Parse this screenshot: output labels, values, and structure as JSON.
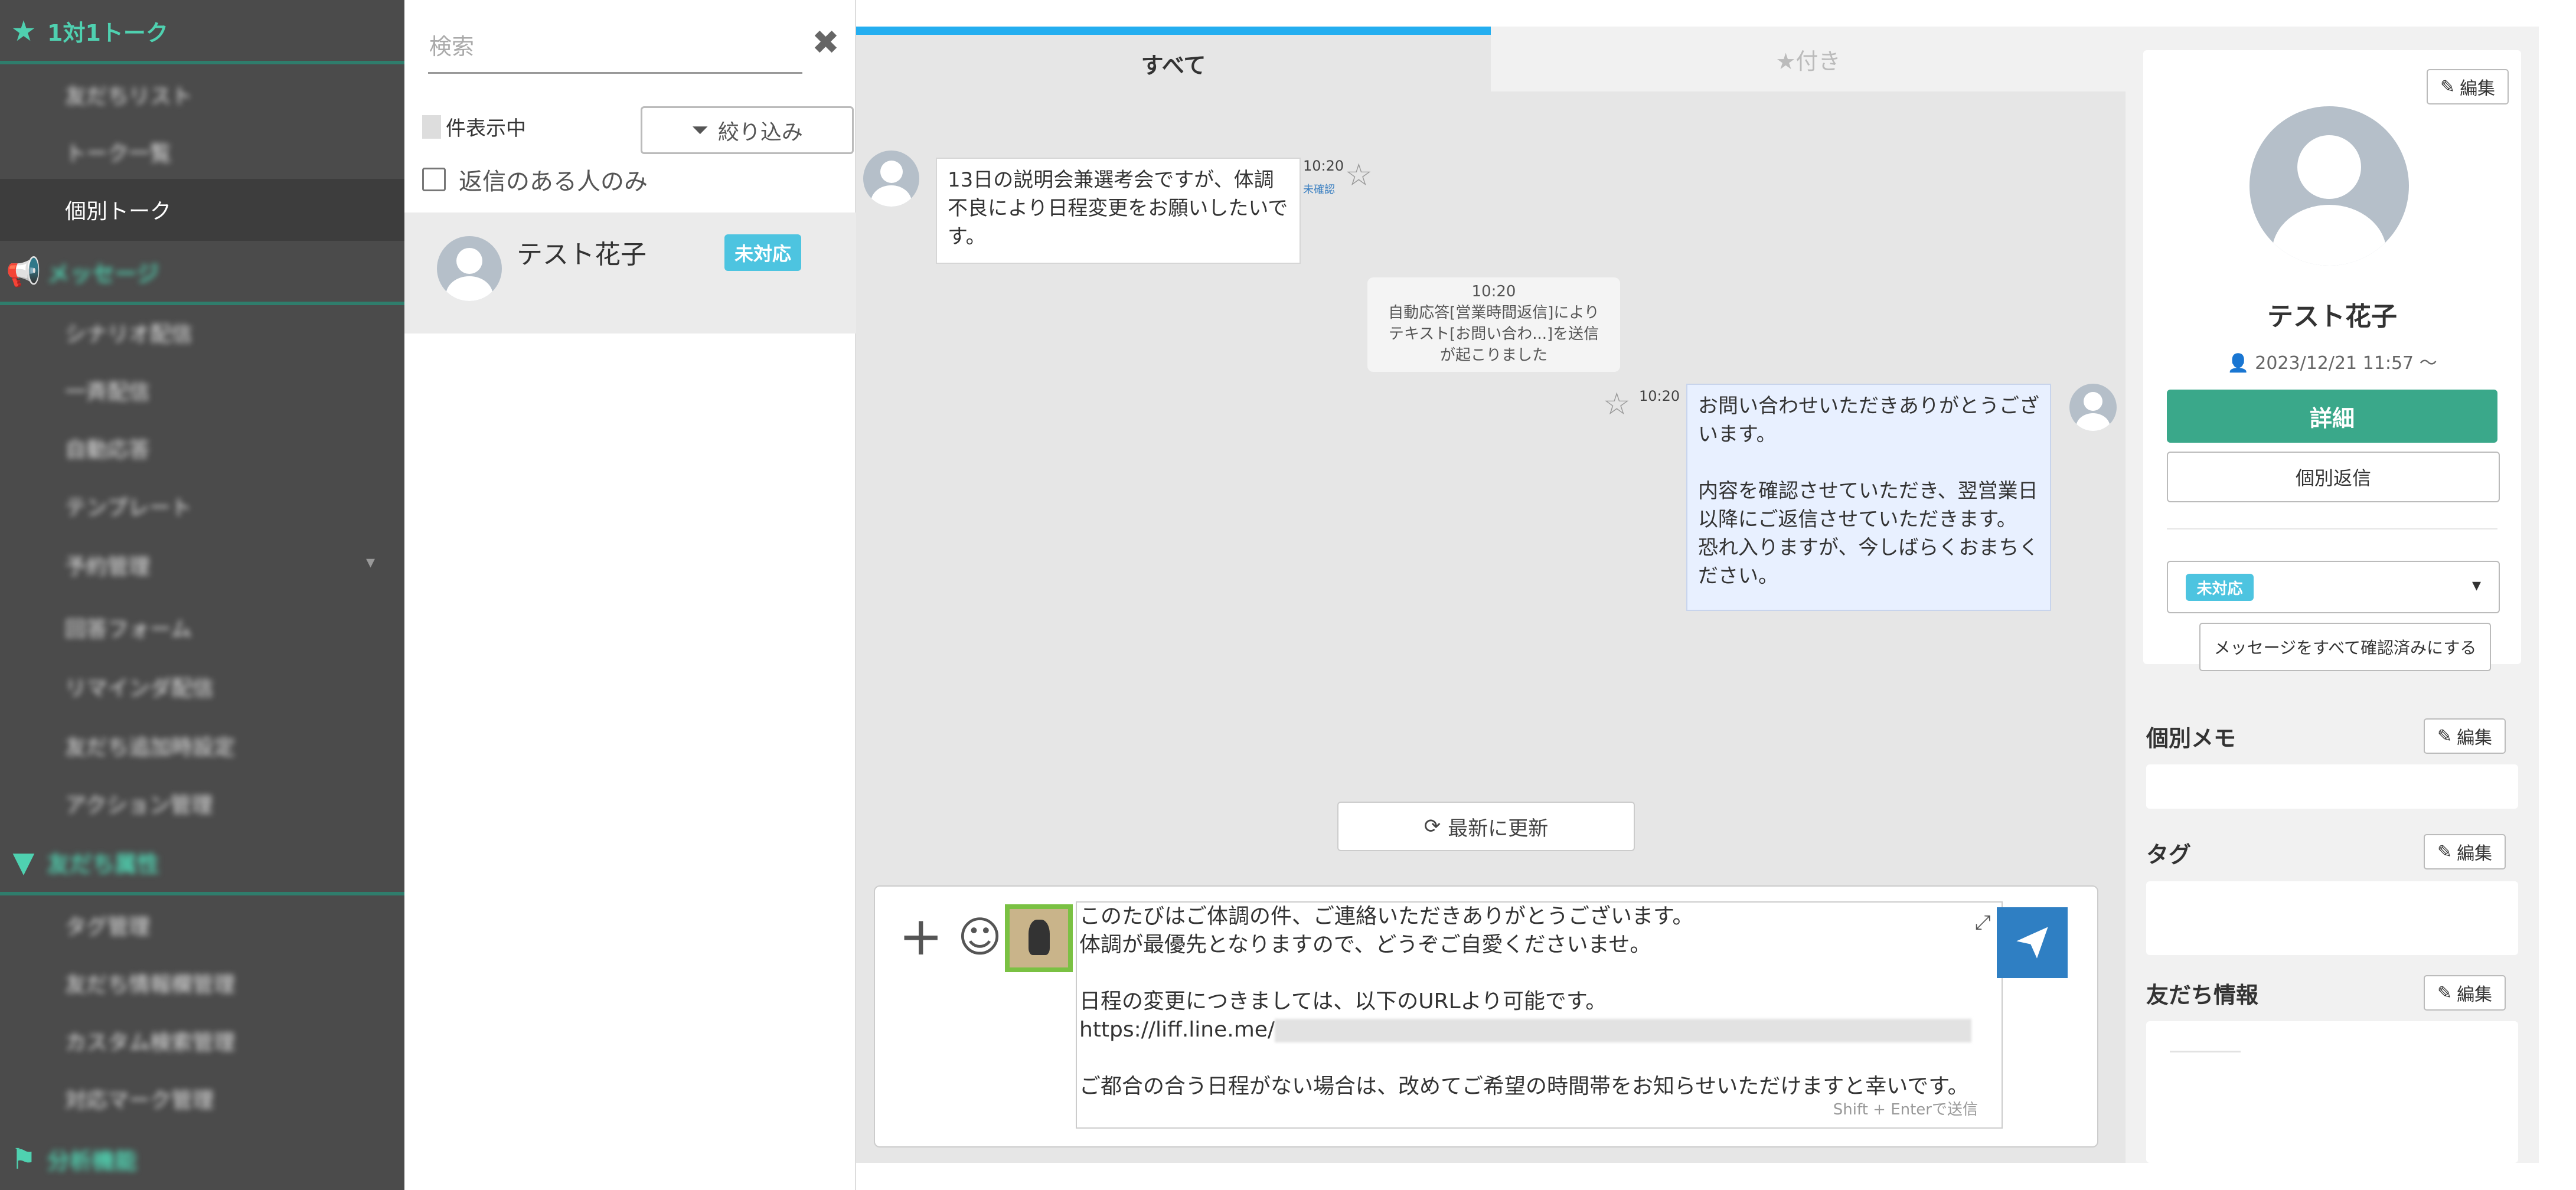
{
  "sidebar": {
    "sections": [
      {
        "label": "1対1トーク",
        "icon": "star-icon"
      },
      {
        "label": "メッセージ",
        "icon": "megaphone-icon"
      },
      {
        "label": "友だち属性",
        "icon": "filter-icon"
      },
      {
        "label": "分析機能",
        "icon": "flag-icon"
      }
    ],
    "items_talk": [
      "友だちリスト",
      "トーク一覧",
      "個別トーク"
    ],
    "items_message": [
      "シナリオ配信",
      "一斉配信",
      "自動応答",
      "テンプレート",
      "予約管理",
      "回答フォーム",
      "リマインダ配信",
      "友だち追加時設定",
      "アクション管理"
    ],
    "items_attr": [
      "タグ管理",
      "友だち情報欄管理",
      "カスタム検索管理",
      "対応マーク管理"
    ]
  },
  "list": {
    "search_placeholder": "検索",
    "count_label": "件表示中",
    "filter_label": "絞り込み",
    "reply_only_label": "返信のある人のみ",
    "conversations": [
      {
        "name": "テスト花子",
        "status": "未対応"
      }
    ]
  },
  "chat": {
    "tab_all": "すべて",
    "tab_starred": "★付き",
    "messages": {
      "incoming_lines": [
        "13日の説明会兼選考会ですが、体調",
        "不良により日程変更をお願いしたいで",
        "す。"
      ],
      "incoming_time": "10:20",
      "incoming_status": "未確認",
      "system_time": "10:20",
      "system_lines": [
        "自動応答[営業時間返信]により",
        "テキスト[お問い合わ...]を送信",
        "が起こりました"
      ],
      "outgoing_time": "10:20",
      "outgoing_lines": [
        "お問い合わせいただきありがとうござ",
        "います。",
        "",
        "内容を確認させていただき、翌営業日",
        "以降にご返信させていただきます。",
        "恐れ入りますが、今しばらくおまちく",
        "ださい。"
      ]
    },
    "refresh_label": "最新に更新",
    "composer": {
      "lines": [
        "このたびはご体調の件、ご連絡いただきありがとうございます。",
        "体調が最優先となりますので、どうぞご自愛くださいませ。",
        "",
        "日程の変更につきましては、以下のURLより可能です。"
      ],
      "url_prefix": "https://liff.line.me/",
      "last_lines": [
        "",
        "ご都合の合う日程がない場合は、改めてご希望の時間帯をお知らせいただけますと幸いです。"
      ],
      "hint": "Shift + Enterで送信"
    }
  },
  "profile": {
    "edit_label": "編集",
    "name": "テスト花子",
    "date": "2023/12/21 11:57 〜",
    "detail_button": "詳細",
    "individual_reply_button": "個別返信",
    "status": "未対応",
    "mark_all_read_button": "メッセージをすべて確認済みにする",
    "memo_title": "個別メモ",
    "tag_title": "タグ",
    "friend_info_title": "友だち情報"
  },
  "colors": {
    "sidebar_bg": "#4b4b4b",
    "accent_green": "#4fd1b0",
    "tab_active": "#24aef0",
    "badge_blue": "#4dc4e0",
    "detail_button": "#3aa88a",
    "send_button": "#2f7fc3"
  }
}
